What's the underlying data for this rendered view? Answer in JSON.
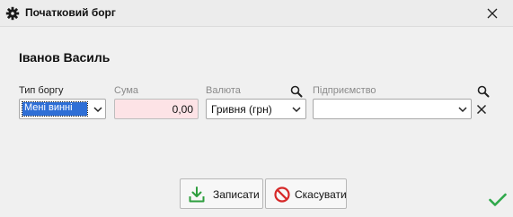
{
  "window": {
    "title": "Початковий борг",
    "icon": "gear-icon",
    "close_icon": "close-icon"
  },
  "person": {
    "name": "Іванов Василь"
  },
  "fields": {
    "debt_type": {
      "label": "Тип боргу",
      "value": "Мені винні"
    },
    "amount": {
      "label": "Сума",
      "value": "0,00"
    },
    "currency": {
      "label": "Валюта",
      "value": "Гривня (грн)"
    },
    "enterprise": {
      "label": "Підприємство",
      "value": ""
    }
  },
  "buttons": {
    "save": {
      "label": "Записати",
      "icon": "download-icon"
    },
    "cancel": {
      "label": "Скасувати",
      "icon": "cancel-icon"
    }
  },
  "status": {
    "icon": "check-icon"
  },
  "colors": {
    "selection": "#2f6fd6",
    "amount_bg": "#fde3e6",
    "save_icon": "#2e9e3e",
    "cancel_icon": "#d62828",
    "check": "#2ea84a"
  }
}
